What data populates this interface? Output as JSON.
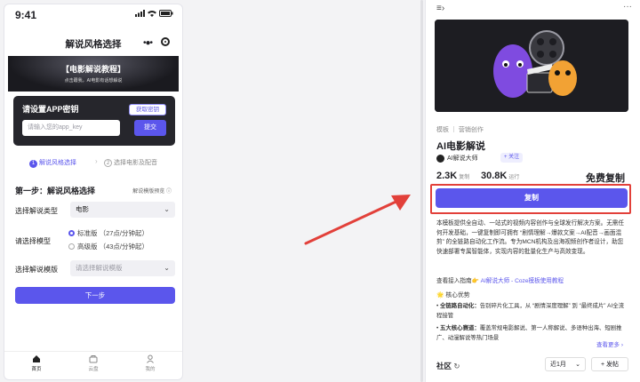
{
  "colors": {
    "accent": "#5b56ec",
    "highlight": "#e2403a",
    "arrow": "#e2403a"
  },
  "phone": {
    "time": "9:41",
    "nav_title": "解说风格选择",
    "banner_title": "【电影解说教程】",
    "banner_sub": "点击跟我，AI电影有话想解说",
    "api": {
      "title": "请设置APP密钥",
      "get_key": "获取密钥",
      "placeholder": "请输入您的app_key",
      "submit": "提交"
    },
    "steps": {
      "s1_num": "1",
      "s1": "解说风格选择",
      "s2_num": "2",
      "s2": "选择电影及配音",
      "sep": "›"
    },
    "section_title": "第一步：解说风格选择",
    "preview_link": "解说模版预览",
    "type_label": "选择解说类型",
    "type_value": "电影",
    "model_label": "请选择模型",
    "model_options": [
      "标准版 （27点/分钟起）",
      "高级版 （43点/分钟起）"
    ],
    "template_label": "选择解说模版",
    "template_placeholder": "请选择解说模版",
    "next_button": "下一步",
    "tabs": [
      "首页",
      "云盘",
      "我的"
    ]
  },
  "panel": {
    "crumb": "模板 ｜ 营销创作",
    "title": "AI电影解说",
    "author": "AI解说大师",
    "follow": "+ 关注",
    "stat1_value": "2.3K",
    "stat1_unit": "复制",
    "stat2_value": "30.8K",
    "stat2_unit": "运行",
    "free_copy": "免费复制",
    "copy_button": "复制",
    "description": "本模板提供全自动、一站式的视频内容创作与全球发行解决方案。无需任何开发基础，一键复制即可拥有 “剧情理解→爆款文案→AI配音→画面混剪” 的全链路自动化工作流。专为MCN机构及出海视频创作者设计，助您快速部署专属智能体，实现内容的批量化生产与高效变现。",
    "guide_prefix": "查看接入指南👉",
    "guide_link": "AI解说大师 - Coze模板使用教程",
    "advantages": "🌟 核心优势",
    "bullet1_title": "全链路自动化：",
    "bullet1_text": "告别碎片化工具，从 “剧情深度理解” 到 “最终成片” AI全流程接管",
    "bullet2_title": "五大核心赛道：",
    "bullet2_text": "覆盖常规电影解说、第一人称解说、多语种出海、短剧推广、动漫解说等热门场景",
    "see_more": "查看更多 ›",
    "community": "社区",
    "month": "近1月",
    "post": "+ 发帖"
  }
}
